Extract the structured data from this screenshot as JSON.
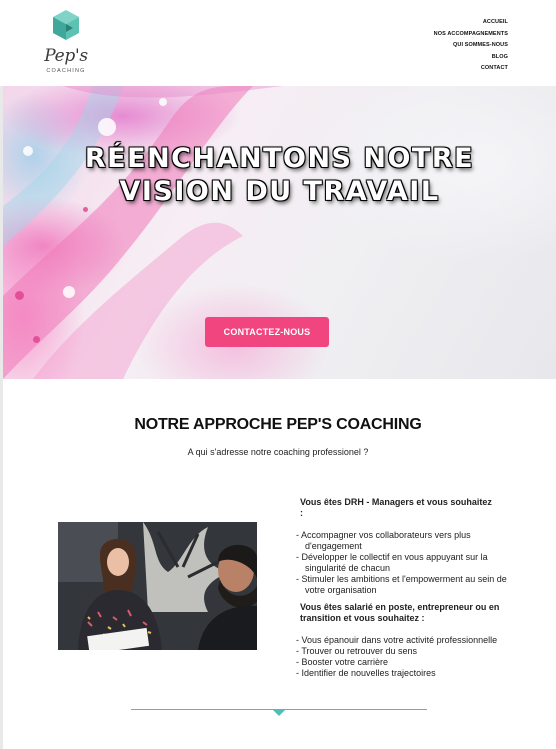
{
  "brand": {
    "name": "Pep's",
    "tagline": "COACHING",
    "colors": {
      "accent": "#f0457e",
      "teal": "#4dbfb4"
    }
  },
  "nav": {
    "items": [
      {
        "label": "ACCUEIL"
      },
      {
        "label": "NOS ACCOMPAGNEMENTS"
      },
      {
        "label": "QUI SOMMES-NOUS"
      },
      {
        "label": "BLOG"
      },
      {
        "label": "CONTACT"
      }
    ]
  },
  "hero": {
    "title_line1": "RÉENCHANTONS NOTRE",
    "title_line2": "VISION DU TRAVAIL",
    "cta_label": "CONTACTEZ-NOUS"
  },
  "approach": {
    "title": "NOTRE APPROCHE PEP'S COACHING",
    "subtitle": "A qui s'adresse notre coaching professionel ?",
    "group1": {
      "heading_line1": "Vous êtes DRH - Managers et vous souhaitez",
      "heading_line2": ":",
      "items": [
        "- Accompagner vos collaborateurs vers plus d'engagement",
        "- Développer le collectif en vous appuyant sur la singularité de chacun",
        "- Stimuler les ambitions et l'empowerment au sein de votre organisation"
      ]
    },
    "group2": {
      "heading": "Vous êtes salarié en poste, entrepreneur ou en transition et vous souhaitez :",
      "items": [
        "- Vous épanouir dans votre activité professionnelle",
        "- Trouver ou retrouver du sens",
        "- Booster votre carrière",
        "- Identifier de nouvelles trajectoires"
      ]
    }
  }
}
